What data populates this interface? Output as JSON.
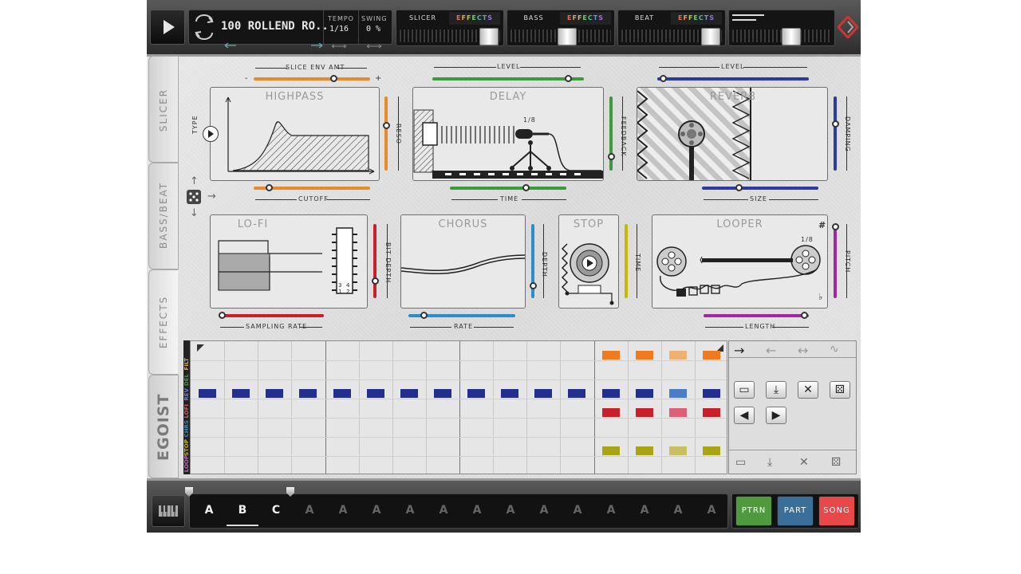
{
  "app": {
    "name": "EGOIST"
  },
  "topbar": {
    "preset_name": "100 ROLLEND RO..",
    "tempo_label": "TEMPO",
    "tempo_value": "1/16",
    "swing_label": "SWING",
    "swing_value": "0 %",
    "groups": [
      {
        "name": "SLICER",
        "fx": "EFFECTS"
      },
      {
        "name": "BASS",
        "fx": "EFFECTS"
      },
      {
        "name": "BEAT",
        "fx": "EFFECTS"
      }
    ]
  },
  "side_tabs": {
    "slicer": "SLICER",
    "bass_beat": "BASS/BEAT",
    "effects": "EFFECTS",
    "logo": "EGOIST"
  },
  "effects": {
    "highpass": {
      "title": "HIGHPASS",
      "top_label": "SLICE ENV AMT",
      "minus": "-",
      "plus": "+",
      "left_label": "TYPE",
      "right_label": "RESO",
      "bottom_label": "CUTOFF"
    },
    "delay": {
      "title": "DELAY",
      "top_label": "LEVEL",
      "right_label": "FEEDBACK",
      "bottom_label": "TIME",
      "note": "1/8"
    },
    "reverb": {
      "title": "REVERB",
      "top_label": "LEVEL",
      "right_label": "DAMPING",
      "bottom_label": "SIZE"
    },
    "lofi": {
      "title": "LO-FI",
      "right_label": "BIT DEPTH",
      "bottom_label": "SAMPLING RATE"
    },
    "chorus": {
      "title": "CHORUS",
      "right_label": "DEPTH",
      "bottom_label": "RATE"
    },
    "stop": {
      "title": "STOP",
      "right_label": "TIME"
    },
    "looper": {
      "title": "LOOPER",
      "right_label": "PITCH",
      "bottom_label": "LENGTH",
      "note": "1/8",
      "sharp": "#",
      "flat": "♭"
    }
  },
  "sequencer": {
    "tracks": [
      {
        "label": "FILT",
        "color": "#e6a817"
      },
      {
        "label": "DEL",
        "color": "#3b9a3b"
      },
      {
        "label": "REV",
        "color": "#2b3b9e"
      },
      {
        "label": "LOFI",
        "color": "#c8202a"
      },
      {
        "label": "CHRS",
        "color": "#2a8fc8"
      },
      {
        "label": "STOP",
        "color": "#c8b800"
      },
      {
        "label": "LOOP",
        "color": "#a028a0"
      }
    ]
  },
  "bottombar": {
    "slots": [
      "A",
      "B",
      "C",
      "A",
      "A",
      "A",
      "A",
      "A",
      "A",
      "A",
      "A",
      "A",
      "A",
      "A",
      "A",
      "A"
    ],
    "modes": [
      {
        "label": "PTRN",
        "color": "#4f9a3f"
      },
      {
        "label": "PART",
        "color": "#3a6f9a"
      },
      {
        "label": "SONG",
        "color": "#e84848"
      }
    ]
  }
}
